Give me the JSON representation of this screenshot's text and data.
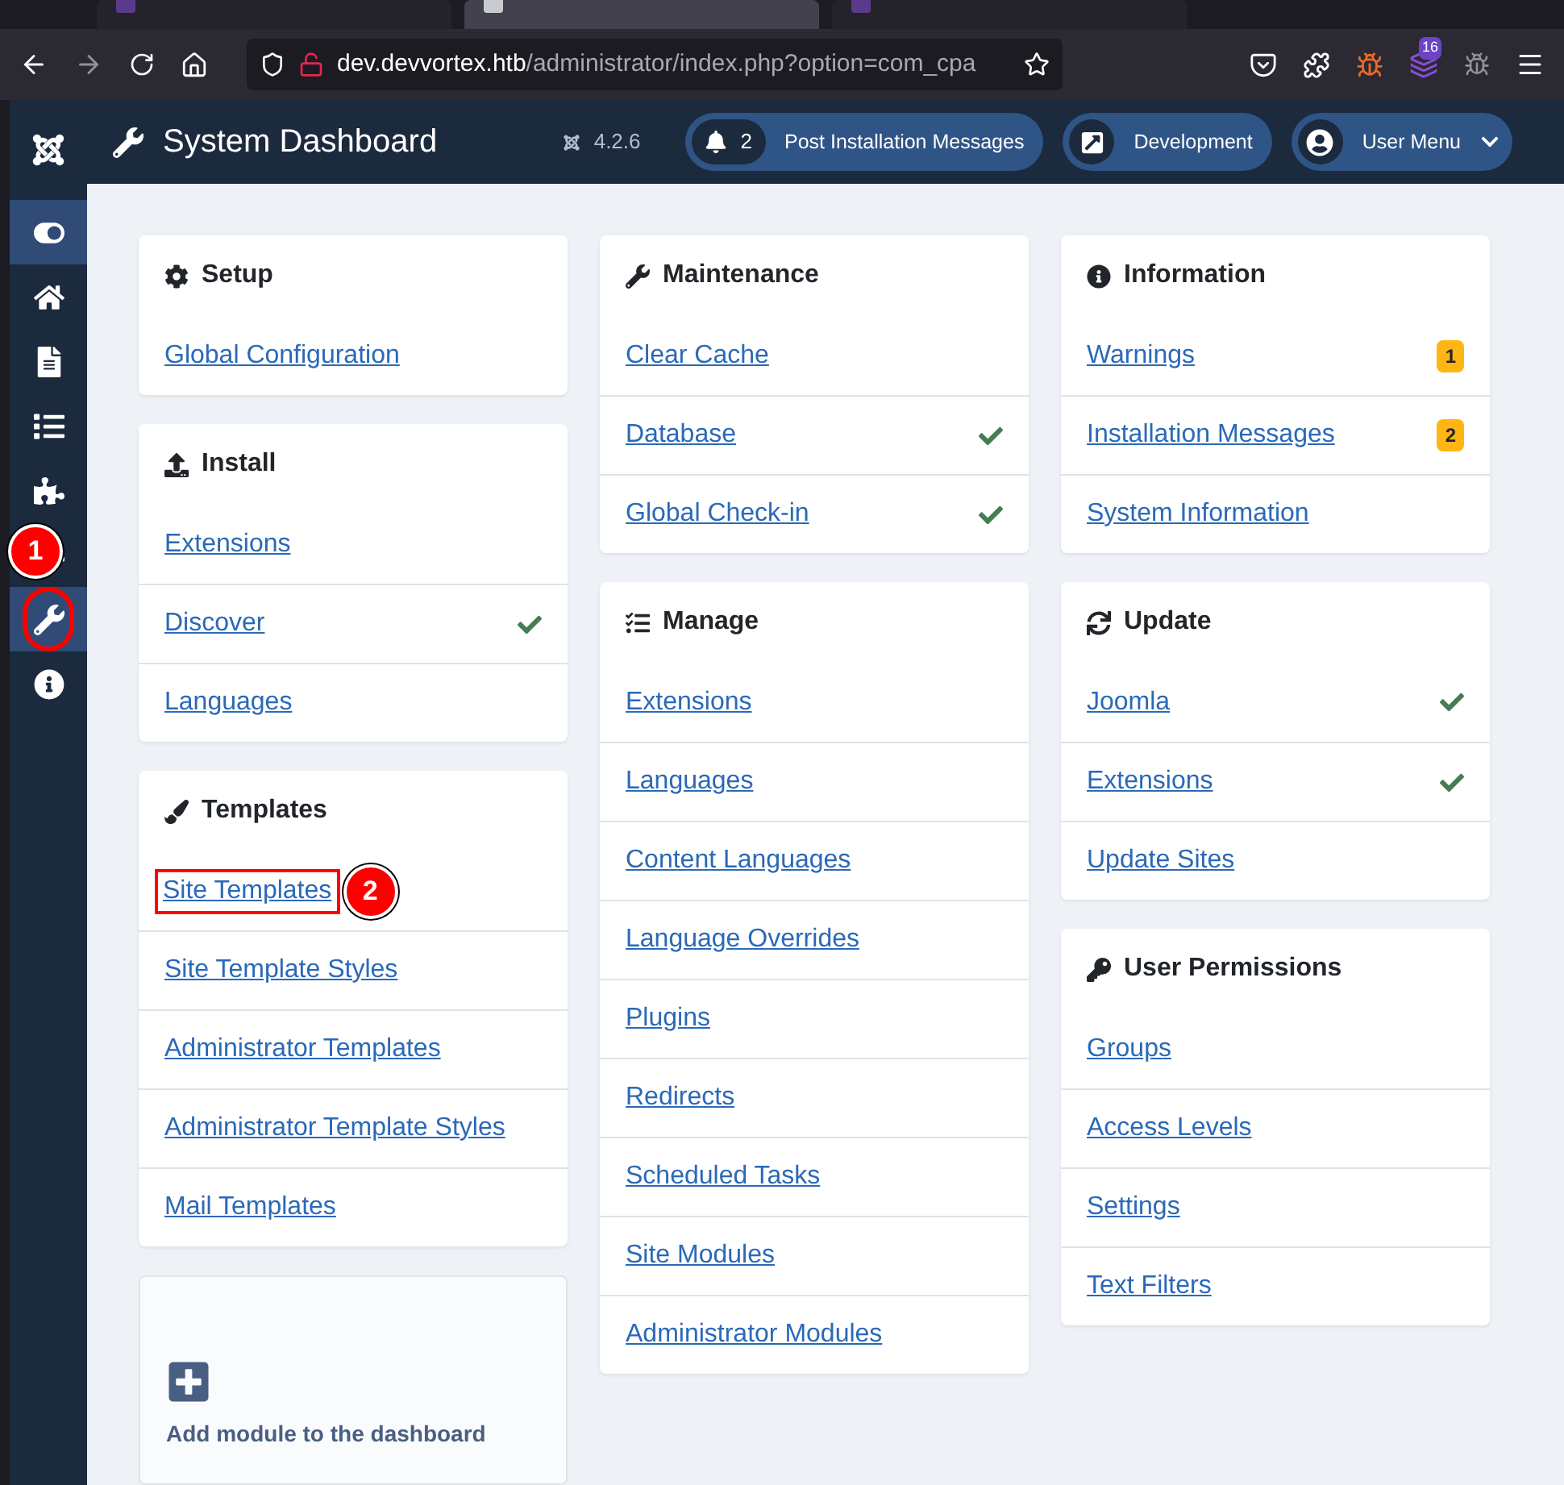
{
  "browser": {
    "tabs": [
      {
        "selected": false
      },
      {
        "selected": true
      },
      {
        "selected": false
      }
    ],
    "url_host": "dev.devvortex.htb",
    "url_path": "/administrator/index.php?option=com_cpa",
    "extension_badge": "16"
  },
  "header": {
    "title": "System Dashboard",
    "version": "4.2.6",
    "buttons": [
      {
        "kind": "messages",
        "count": "2",
        "label": "Post Installation Messages"
      },
      {
        "kind": "external",
        "label": "Development"
      },
      {
        "kind": "user",
        "label": "User Menu"
      }
    ]
  },
  "sidebar": {
    "items": [
      {
        "kind": "toggle",
        "selected": true
      },
      {
        "kind": "home",
        "selected": false
      },
      {
        "kind": "content",
        "selected": false
      },
      {
        "kind": "menus",
        "selected": false
      },
      {
        "kind": "components",
        "selected": false
      },
      {
        "kind": "users",
        "selected": false
      },
      {
        "kind": "system",
        "selected": true,
        "annotation": "1"
      },
      {
        "kind": "help",
        "selected": false
      }
    ]
  },
  "columns": [
    [
      {
        "kind": "setup",
        "title": "Setup",
        "items": [
          {
            "label": "Global Configuration"
          }
        ]
      },
      {
        "kind": "install",
        "title": "Install",
        "items": [
          {
            "label": "Extensions"
          },
          {
            "label": "Discover",
            "check": true
          },
          {
            "label": "Languages"
          }
        ]
      },
      {
        "kind": "templates",
        "title": "Templates",
        "items": [
          {
            "label": "Site Templates",
            "annotation": "2"
          },
          {
            "label": "Site Template Styles"
          },
          {
            "label": "Administrator Templates"
          },
          {
            "label": "Administrator Template Styles"
          },
          {
            "label": "Mail Templates"
          }
        ]
      },
      {
        "kind": "add",
        "title": "Add module to the dashboard"
      }
    ],
    [
      {
        "kind": "maintenance",
        "title": "Maintenance",
        "items": [
          {
            "label": "Clear Cache"
          },
          {
            "label": "Database",
            "check": true
          },
          {
            "label": "Global Check-in",
            "check": true
          }
        ]
      },
      {
        "kind": "manage",
        "title": "Manage",
        "items": [
          {
            "label": "Extensions"
          },
          {
            "label": "Languages"
          },
          {
            "label": "Content Languages"
          },
          {
            "label": "Language Overrides"
          },
          {
            "label": "Plugins"
          },
          {
            "label": "Redirects"
          },
          {
            "label": "Scheduled Tasks"
          },
          {
            "label": "Site Modules"
          },
          {
            "label": "Administrator Modules"
          }
        ]
      }
    ],
    [
      {
        "kind": "information",
        "title": "Information",
        "items": [
          {
            "label": "Warnings",
            "badge": "1"
          },
          {
            "label": "Installation Messages",
            "badge": "2"
          },
          {
            "label": "System Information"
          }
        ]
      },
      {
        "kind": "update",
        "title": "Update",
        "items": [
          {
            "label": "Joomla",
            "check": true
          },
          {
            "label": "Extensions",
            "check": true
          },
          {
            "label": "Update Sites"
          }
        ]
      },
      {
        "kind": "permissions",
        "title": "User Permissions",
        "items": [
          {
            "label": "Groups"
          },
          {
            "label": "Access Levels"
          },
          {
            "label": "Settings"
          },
          {
            "label": "Text Filters"
          }
        ]
      }
    ]
  ]
}
